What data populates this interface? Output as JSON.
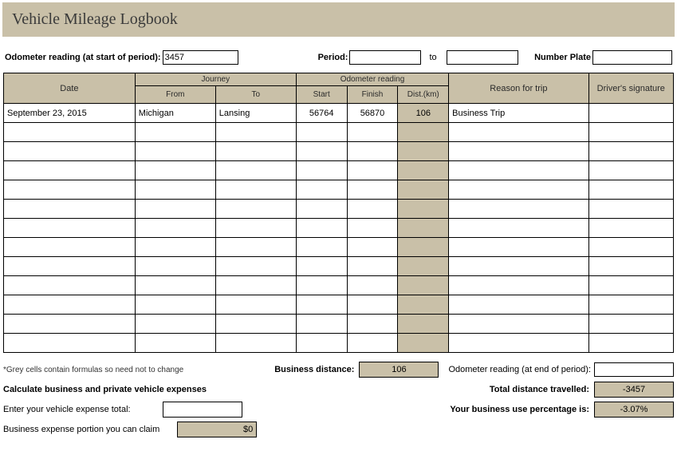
{
  "title": "Vehicle Mileage Logbook",
  "info": {
    "odometer_label": "Odometer reading (at start of period):",
    "odometer_value": "3457",
    "period_label": "Period:",
    "period_from": "",
    "period_mid": "to",
    "period_to": "",
    "plate_label": "Number Plate",
    "plate_value": ""
  },
  "headers": {
    "date": "Date",
    "journey": "Journey",
    "from": "From",
    "to": "To",
    "odometer": "Odometer reading",
    "start": "Start",
    "finish": "Finish",
    "dist": "Dist.(km)",
    "reason": "Reason for trip",
    "signature": "Driver's signature"
  },
  "rows": [
    {
      "date": "September 23, 2015",
      "from": "Michigan",
      "to": "Lansing",
      "start": "56764",
      "finish": "56870",
      "dist": "106",
      "reason": "Business Trip",
      "sig": ""
    },
    {
      "date": "",
      "from": "",
      "to": "",
      "start": "",
      "finish": "",
      "dist": "",
      "reason": "",
      "sig": ""
    },
    {
      "date": "",
      "from": "",
      "to": "",
      "start": "",
      "finish": "",
      "dist": "",
      "reason": "",
      "sig": ""
    },
    {
      "date": "",
      "from": "",
      "to": "",
      "start": "",
      "finish": "",
      "dist": "",
      "reason": "",
      "sig": ""
    },
    {
      "date": "",
      "from": "",
      "to": "",
      "start": "",
      "finish": "",
      "dist": "",
      "reason": "",
      "sig": ""
    },
    {
      "date": "",
      "from": "",
      "to": "",
      "start": "",
      "finish": "",
      "dist": "",
      "reason": "",
      "sig": ""
    },
    {
      "date": "",
      "from": "",
      "to": "",
      "start": "",
      "finish": "",
      "dist": "",
      "reason": "",
      "sig": ""
    },
    {
      "date": "",
      "from": "",
      "to": "",
      "start": "",
      "finish": "",
      "dist": "",
      "reason": "",
      "sig": ""
    },
    {
      "date": "",
      "from": "",
      "to": "",
      "start": "",
      "finish": "",
      "dist": "",
      "reason": "",
      "sig": ""
    },
    {
      "date": "",
      "from": "",
      "to": "",
      "start": "",
      "finish": "",
      "dist": "",
      "reason": "",
      "sig": ""
    },
    {
      "date": "",
      "from": "",
      "to": "",
      "start": "",
      "finish": "",
      "dist": "",
      "reason": "",
      "sig": ""
    },
    {
      "date": "",
      "from": "",
      "to": "",
      "start": "",
      "finish": "",
      "dist": "",
      "reason": "",
      "sig": ""
    },
    {
      "date": "",
      "from": "",
      "to": "",
      "start": "",
      "finish": "",
      "dist": "",
      "reason": "",
      "sig": ""
    }
  ],
  "footer": {
    "note": "*Grey cells contain formulas so need not to change",
    "biz_dist_label": "Business distance:",
    "biz_dist_value": "106",
    "end_odo_label": "Odometer reading (at end of period):",
    "end_odo_value": "",
    "calc_label": "Calculate business and private vehicle expenses",
    "total_dist_label": "Total distance travelled:",
    "total_dist_value": "-3457",
    "expense_label": "Enter your vehicle expense total:",
    "expense_value": "",
    "pct_label": "Your business use percentage is:",
    "pct_value": "-3.07%",
    "claim_label": "Business expense portion you can claim",
    "claim_value": "$0"
  }
}
